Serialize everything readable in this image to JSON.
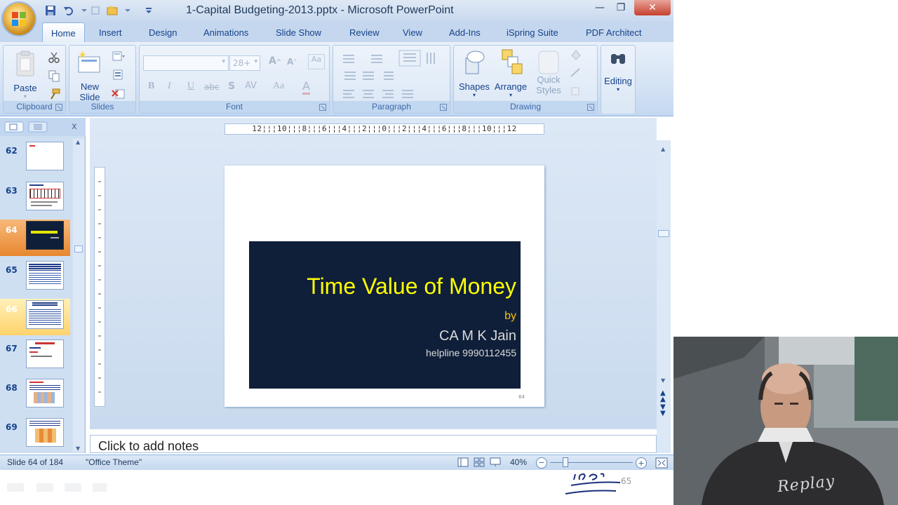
{
  "window": {
    "title": "1-Capital Budgeting-2013.pptx - Microsoft PowerPoint",
    "minimize": "—",
    "restore": "❐",
    "close": "✕"
  },
  "tabs": [
    "Home",
    "Insert",
    "Design",
    "Animations",
    "Slide Show",
    "Review",
    "View",
    "Add-Ins",
    "iSpring Suite",
    "PDF Architect"
  ],
  "ribbon": {
    "clipboard": {
      "label": "Clipboard",
      "paste": "Paste"
    },
    "slides": {
      "label": "Slides",
      "new_slide": "New Slide"
    },
    "font": {
      "label": "Font",
      "size": "28+",
      "bold": "B",
      "italic": "I",
      "underline": "U",
      "strike": "abc",
      "shadow": "S",
      "spacing": "AV",
      "case": "Aa",
      "color": "A"
    },
    "paragraph": {
      "label": "Paragraph"
    },
    "drawing": {
      "label": "Drawing",
      "shapes": "Shapes",
      "arrange": "Arrange",
      "quick_styles": "Quick Styles"
    },
    "editing": {
      "label": "Editing"
    }
  },
  "pane": {
    "close": "x",
    "thumbnails": [
      {
        "num": "62"
      },
      {
        "num": "63"
      },
      {
        "num": "64"
      },
      {
        "num": "65"
      },
      {
        "num": "66"
      },
      {
        "num": "67"
      },
      {
        "num": "68"
      },
      {
        "num": "69"
      }
    ]
  },
  "ruler": {
    "marks": "12¦¦¦10¦¦¦8¦¦¦6¦¦¦4¦¦¦2¦¦¦0¦¦¦2¦¦¦4¦¦¦6¦¦¦8¦¦¦10¦¦¦12"
  },
  "slide": {
    "title": "Time Value of Money",
    "by": "by",
    "author": "CA  M K Jain",
    "helpline": "helpline 9990112455",
    "page_num": "64"
  },
  "notes": {
    "placeholder": "Click to add notes"
  },
  "status": {
    "slide": "Slide 64 of 184",
    "theme": "\"Office Theme\"",
    "zoom": "40%"
  },
  "overlay": {
    "number": "65"
  },
  "webcam": {
    "shirt_text": "Replay"
  },
  "colors": {
    "ribbon": "#d0e0f3",
    "slide_bg": "#0f1f3a",
    "title": "#ffff00",
    "accent_orange": "#e8872f"
  }
}
